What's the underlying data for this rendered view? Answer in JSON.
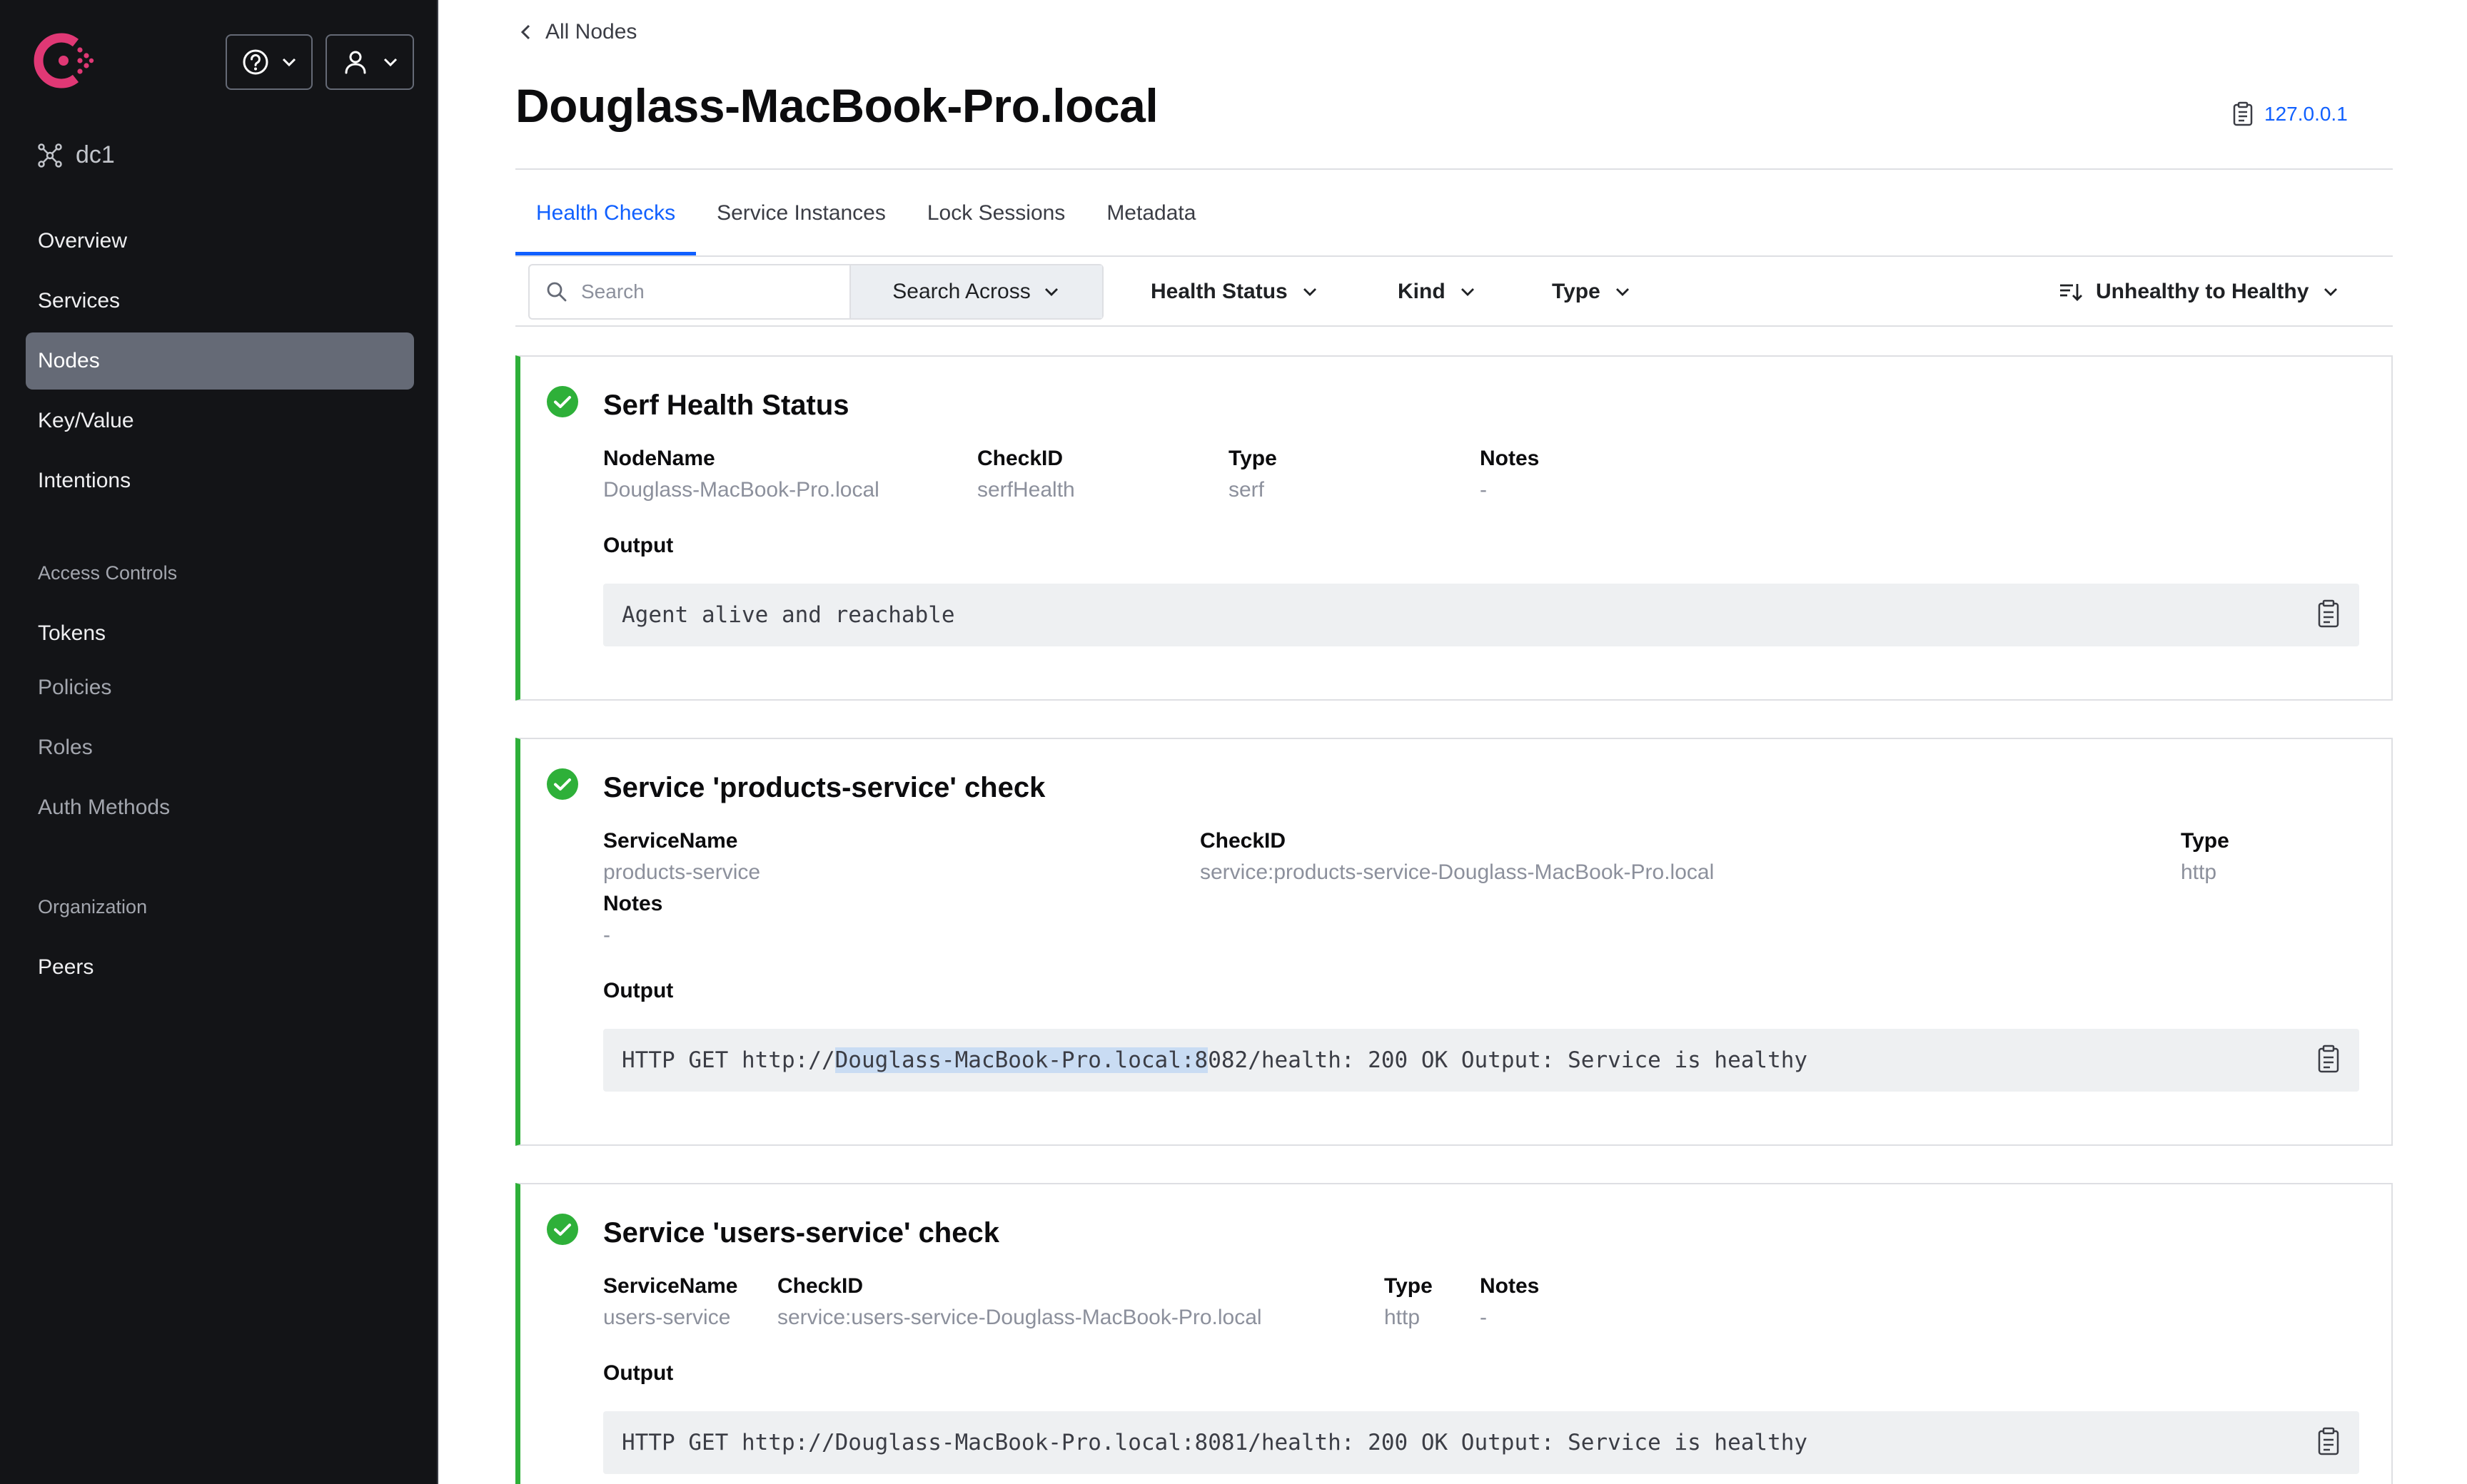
{
  "sidebar": {
    "datacenter": "dc1",
    "nav": [
      "Overview",
      "Services",
      "Nodes",
      "Key/Value",
      "Intentions"
    ],
    "active": "Nodes",
    "access_controls": {
      "heading": "Access Controls",
      "items": [
        "Tokens",
        "Policies",
        "Roles",
        "Auth Methods"
      ]
    },
    "organization": {
      "heading": "Organization",
      "items": [
        "Peers"
      ]
    }
  },
  "breadcrumb": "All Nodes",
  "node": {
    "title": "Douglass-MacBook-Pro.local",
    "address": "127.0.0.1"
  },
  "tabs": [
    "Health Checks",
    "Service Instances",
    "Lock Sessions",
    "Metadata"
  ],
  "filters": {
    "search_placeholder": "Search",
    "search_across": "Search Across",
    "health_status": "Health Status",
    "kind": "Kind",
    "type": "Type",
    "sort": "Unhealthy to Healthy"
  },
  "checks": [
    {
      "title": "Serf Health Status",
      "fields": [
        {
          "label": "NodeName",
          "value": "Douglass-MacBook-Pro.local"
        },
        {
          "label": "CheckID",
          "value": "serfHealth"
        },
        {
          "label": "Type",
          "value": "serf"
        },
        {
          "label": "Notes",
          "value": "-"
        }
      ],
      "output_label": "Output",
      "output": "Agent alive and reachable"
    },
    {
      "title": "Service 'products-service' check",
      "fields": [
        {
          "label": "ServiceName",
          "value": "products-service"
        },
        {
          "label": "CheckID",
          "value": "service:products-service-Douglass-MacBook-Pro.local"
        },
        {
          "label": "Type",
          "value": "http"
        },
        {
          "label": "Notes",
          "value": "-"
        }
      ],
      "output_label": "Output",
      "output_before": "HTTP GET http://",
      "output_selected": "Douglass-MacBook-Pro.local:8",
      "output_after": "082/health: 200 OK Output: Service is healthy"
    },
    {
      "title": "Service 'users-service' check",
      "fields": [
        {
          "label": "ServiceName",
          "value": "users-service"
        },
        {
          "label": "CheckID",
          "value": "service:users-service-Douglass-MacBook-Pro.local"
        },
        {
          "label": "Type",
          "value": "http"
        },
        {
          "label": "Notes",
          "value": "-"
        }
      ],
      "output_label": "Output",
      "output": "HTTP GET http://Douglass-MacBook-Pro.local:8081/health: 200 OK Output: Service is healthy"
    }
  ],
  "colors": {
    "sidebar_bg": "#131417",
    "brand": "#e03875",
    "link": "#1060ff",
    "passing": "#2eb039"
  }
}
